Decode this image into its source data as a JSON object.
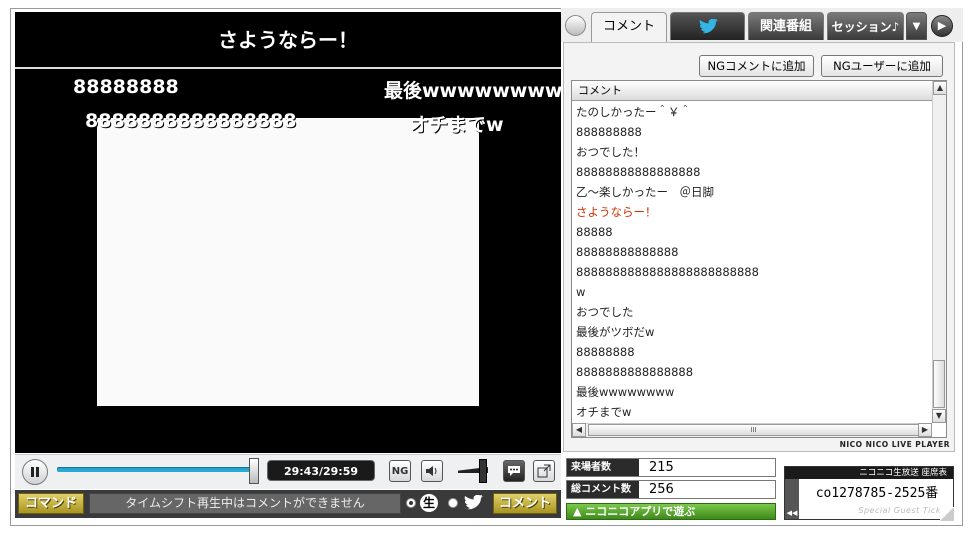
{
  "video": {
    "telop": "さようならー！",
    "flowing_comments": [
      "88888888",
      "最後wwwwwwww",
      "8888888888888888",
      "オチまでw"
    ]
  },
  "controls": {
    "time": "29:43/29:59",
    "seek_fraction": 0.99,
    "ng_icon_label": "NG",
    "command_button": "コマンド",
    "comment_input_placeholder": "タイムシフト再生中はコメントができません",
    "nama_label": "生",
    "comment_post_button": "コメント"
  },
  "tabs": [
    {
      "label": "コメント",
      "active": true
    },
    {
      "label": "",
      "icon": "twitter-bird-icon"
    },
    {
      "label": "関連番組"
    },
    {
      "label": "セッション♪"
    }
  ],
  "comment_panel": {
    "ng_comment_button": "NGコメントに追加",
    "ng_user_button": "NGユーザーに追加",
    "column_header": "コメント",
    "comments": [
      {
        "text": "たのしかったー＾￥＾"
      },
      {
        "text": "888888888"
      },
      {
        "text": "おつでした！"
      },
      {
        "text": "88888888888888888"
      },
      {
        "text": "乙〜楽しかったー　＠日脚"
      },
      {
        "text": "さようならー！",
        "color": "#cc3300"
      },
      {
        "text": "88888"
      },
      {
        "text": "88888888888888"
      },
      {
        "text": "8888888888888888888888888"
      },
      {
        "text": "w"
      },
      {
        "text": "おつでした"
      },
      {
        "text": "最後がツボだw"
      },
      {
        "text": "88888888"
      },
      {
        "text": "8888888888888888"
      },
      {
        "text": "最後wwwwwwww"
      },
      {
        "text": "オチまでw"
      }
    ],
    "hscroll_label": "III",
    "brand": "NICO NICO LIVE PLAYER"
  },
  "stats": {
    "visitors_label": "来場者数",
    "visitors": "215",
    "comments_label": "総コメント数",
    "comments": "256",
    "app_button": "ニコニコアプリで遊ぶ"
  },
  "ticket": {
    "header": "ニコニコ生放送 座席表",
    "number": "co1278785-2525番",
    "subtitle": "Special Guest Ticket"
  }
}
